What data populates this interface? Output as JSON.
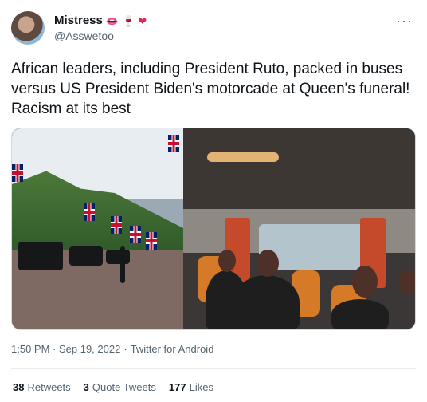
{
  "tweet": {
    "display_name": "Mistress",
    "handle": "@Asswetoo",
    "badges": [
      "lips-emoji",
      "wine-glass-emoji",
      "red-heart-emoji"
    ],
    "text": "African leaders, including President Ruto, packed in buses versus US President Biden's motorcade at Queen's funeral! Racism at its best",
    "timestamp": "1:50 PM · Sep 19, 2022",
    "source": "Twitter for Android",
    "stats": [
      {
        "count": "38",
        "label": "Retweets"
      },
      {
        "count": "3",
        "label": "Quote Tweets"
      },
      {
        "count": "177",
        "label": "Likes"
      }
    ],
    "more_icon": "ellipsis-horizontal-icon"
  }
}
